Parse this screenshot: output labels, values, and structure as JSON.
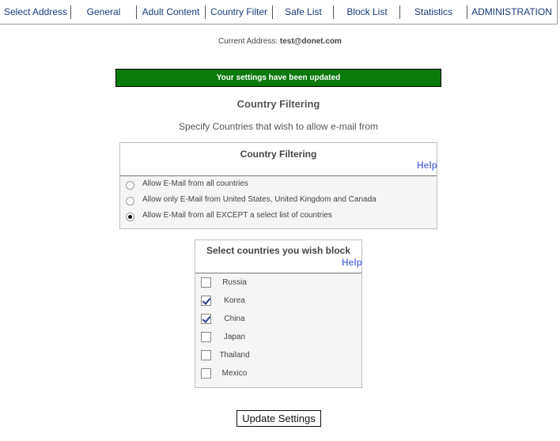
{
  "nav": {
    "items": [
      {
        "label": "Select Address"
      },
      {
        "label": "General"
      },
      {
        "label": "Adult Content"
      },
      {
        "label": "Country Filter"
      },
      {
        "label": "Safe List"
      },
      {
        "label": "Block List"
      },
      {
        "label": "Statistics"
      },
      {
        "label": "ADMINISTRATION"
      }
    ]
  },
  "address": {
    "label": "Current Address:",
    "value": "test@donet.com"
  },
  "status": {
    "message": "Your settings have been updated",
    "color": "#0a7a0a"
  },
  "page": {
    "title": "Country Filtering",
    "subtitle": "Specify Countries that wish to allow e-mail from"
  },
  "filter_panel": {
    "title": "Country Filtering",
    "help": "Help",
    "options": [
      {
        "label": "Allow E-Mail from all countries",
        "selected": false
      },
      {
        "label": "Allow only E-Mail from United States, United Kingdom and Canada",
        "selected": false
      },
      {
        "label": "Allow E-Mail from all EXCEPT a select list of countries",
        "selected": true
      }
    ]
  },
  "countries_panel": {
    "title": "Select countries you wish block",
    "help": "Help",
    "countries": [
      {
        "name": "Russia",
        "checked": false
      },
      {
        "name": "Korea",
        "checked": true
      },
      {
        "name": "China",
        "checked": true
      },
      {
        "name": "Japan",
        "checked": false
      },
      {
        "name": "Thailand",
        "checked": false
      },
      {
        "name": "Mexico",
        "checked": false
      }
    ]
  },
  "actions": {
    "update_label": "Update Settings"
  }
}
